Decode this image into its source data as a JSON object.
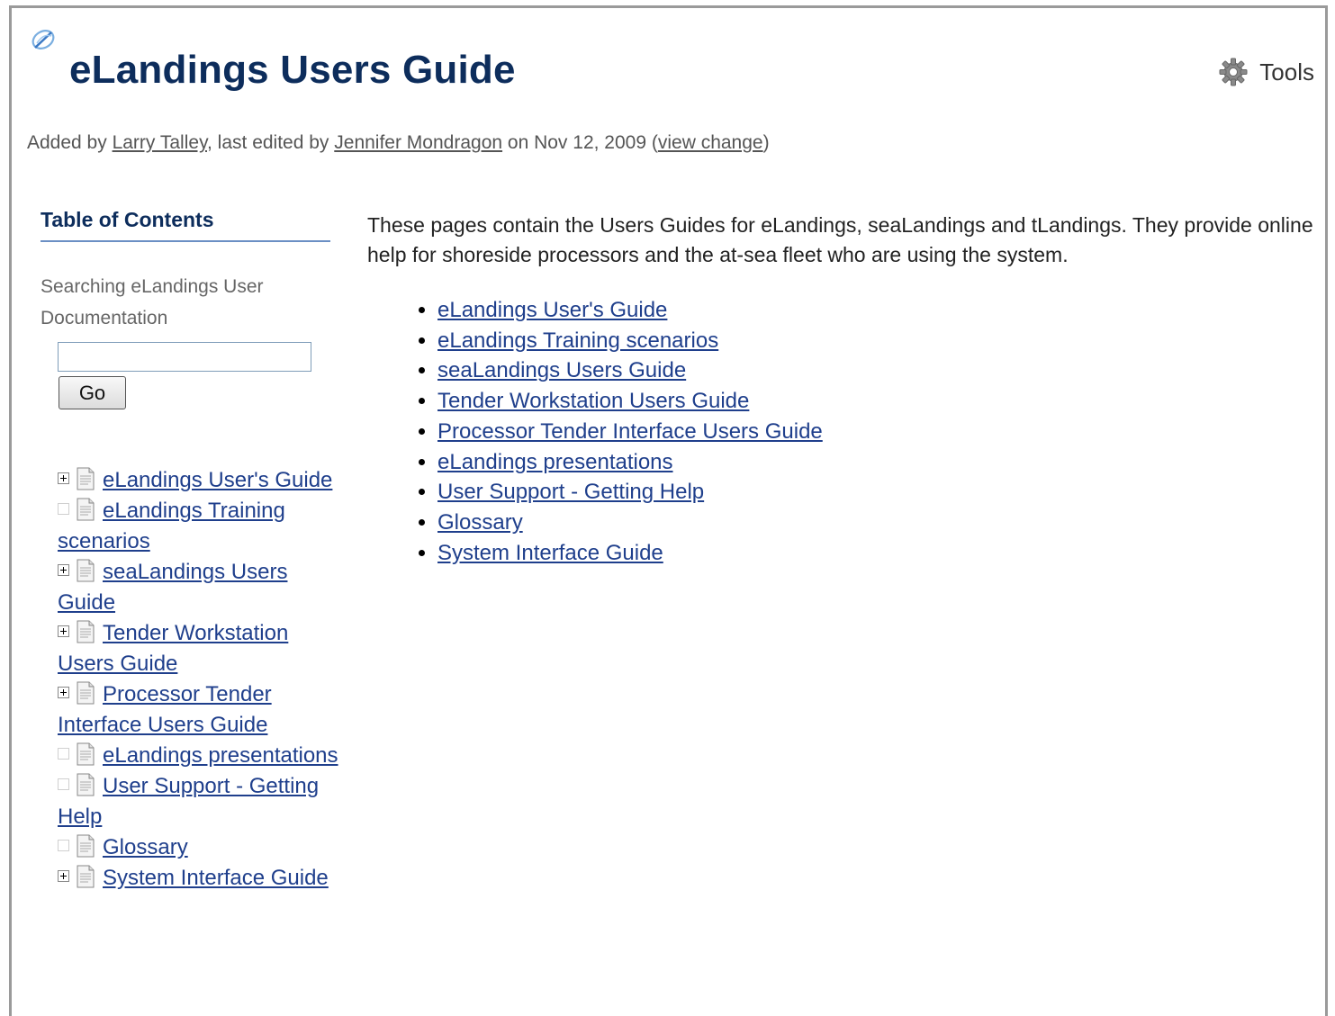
{
  "page": {
    "title": "eLandings Users Guide",
    "tools_label": "Tools"
  },
  "byline": {
    "added_by_prefix": "Added by ",
    "author": "Larry Talley",
    "edited_by_prefix": ", last edited by ",
    "editor": "Jennifer Mondragon",
    "date_text": " on Nov 12, 2009  (",
    "view_change": "view change",
    "close_paren": ")"
  },
  "sidebar": {
    "toc_title": "Table of Contents",
    "search_label": "Searching eLandings User Documentation",
    "search_value": "",
    "go_label": "Go",
    "tree": [
      {
        "label": "eLandings User's Guide",
        "expandable": true
      },
      {
        "label": "eLandings Training scenarios",
        "expandable": false
      },
      {
        "label": "seaLandings Users Guide",
        "expandable": true
      },
      {
        "label": "Tender Workstation Users Guide",
        "expandable": true
      },
      {
        "label": "Processor Tender Interface Users Guide",
        "expandable": true
      },
      {
        "label": "eLandings presentations",
        "expandable": false
      },
      {
        "label": "User Support - Getting Help",
        "expandable": false
      },
      {
        "label": "Glossary",
        "expandable": false
      },
      {
        "label": "System Interface Guide",
        "expandable": true
      }
    ]
  },
  "main": {
    "intro": "These pages contain the Users Guides for eLandings, seaLandings and tLandings.  They provide online help for shoreside processors and the at-sea fleet who are using the system.",
    "links": [
      "eLandings User's Guide",
      "eLandings Training scenarios",
      "seaLandings Users Guide",
      "Tender Workstation Users Guide",
      "Processor Tender Interface Users Guide",
      "eLandings presentations",
      "User Support - Getting Help",
      "Glossary",
      "System Interface Guide"
    ]
  },
  "colors": {
    "title": "#0d2d5c",
    "link": "#1f3f8c",
    "frame_border": "#9a9a9a"
  },
  "icons": {
    "page": "page-logo-icon",
    "tools": "gear-icon",
    "tree_doc": "document-icon",
    "tree_toggle": "expand-plus-icon"
  }
}
